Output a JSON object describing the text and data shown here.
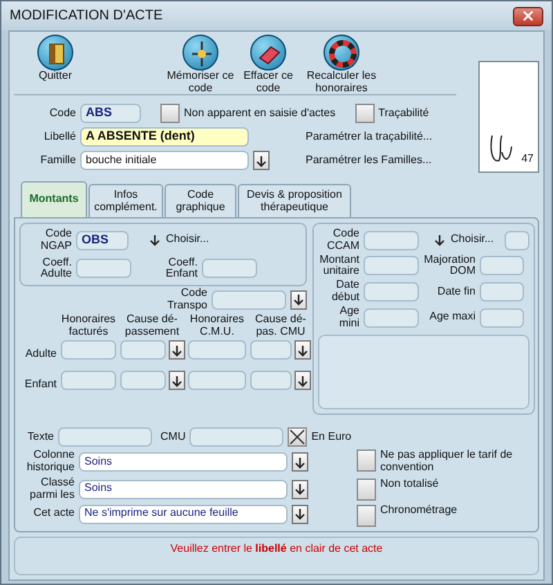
{
  "window": {
    "title": "MODIFICATION D'ACTE"
  },
  "toolbar": [
    {
      "kind": "quit",
      "label": "Quitter"
    },
    {
      "kind": "save",
      "label": "Mémoriser ce code"
    },
    {
      "kind": "erase",
      "label": "Effacer ce code"
    },
    {
      "kind": "recalc",
      "label": "Recalculer les honoraires"
    }
  ],
  "header": {
    "code": {
      "label": "Code",
      "value": "ABS"
    },
    "libelle": {
      "label": "Libellé",
      "value": "A ABSENTE (dent)"
    },
    "famille": {
      "label": "Famille",
      "value": "bouche initiale"
    },
    "options": [
      {
        "label": "Non apparent en saisie d'actes",
        "checked": false
      },
      {
        "label": "Traçabilité",
        "checked": false
      }
    ],
    "links": [
      "Paramétrer la traçabilité...",
      "Paramétrer les Familles..."
    ]
  },
  "thumbnail": {
    "caption": "47"
  },
  "tabs": [
    {
      "label": "Montants",
      "selected": true
    },
    {
      "label": "Infos complément.",
      "selected": false
    },
    {
      "label": "Code graphique",
      "selected": false
    },
    {
      "label": "Devis & proposition thérapeutique",
      "selected": false
    }
  ],
  "ngap": {
    "code_label": "Code NGAP",
    "code": "OBS",
    "choose": "Choisir...",
    "coeff_labels": [
      "Coeff. Adulte",
      "Coeff. Enfant"
    ]
  },
  "transpo_label": "Code Transpo",
  "fees": {
    "columns": [
      "Honoraires facturés",
      "Cause dé-passement",
      "Honoraires C.M.U.",
      "Cause dé-pas. CMU"
    ],
    "rows": [
      "Adulte",
      "Enfant"
    ]
  },
  "ccam": {
    "code_label": "Code CCAM",
    "choose": "Choisir...",
    "fields": [
      "Montant unitaire",
      "Majoration DOM",
      "Date début",
      "Date fin",
      "Age mini",
      "Age maxi"
    ]
  },
  "misc": {
    "texte_label": "Texte",
    "cmu_label": "CMU",
    "euro": {
      "label": "En Euro",
      "checked": true
    }
  },
  "selects": [
    {
      "label": "Colonne historique",
      "value": "Soins"
    },
    {
      "label": "Classé parmi les",
      "value": "Soins"
    },
    {
      "label": "Cet acte",
      "value": "Ne s'imprime sur aucune feuille"
    }
  ],
  "flags": [
    {
      "label": "Ne pas appliquer le tarif de convention",
      "checked": false
    },
    {
      "label": "Non totalisé",
      "checked": false
    },
    {
      "label": "Chronométrage",
      "checked": false
    }
  ],
  "status": "Veuillez entrer le **libellé** en clair de cet acte"
}
